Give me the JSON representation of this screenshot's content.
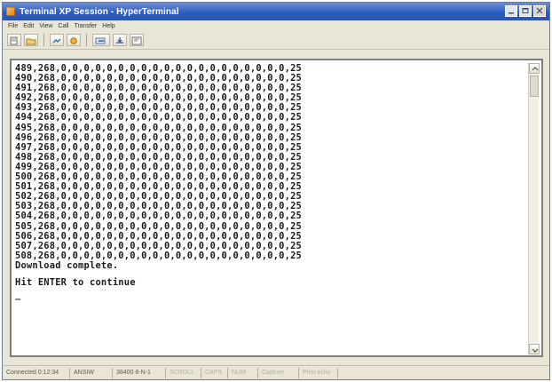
{
  "window": {
    "title": "Terminal XP Session - HyperTerminal",
    "minimize_label": "",
    "maximize_label": "",
    "close_label": ""
  },
  "menu": {
    "items": [
      {
        "label": "File"
      },
      {
        "label": "Edit"
      },
      {
        "label": "View"
      },
      {
        "label": "Call"
      },
      {
        "label": "Transfer"
      },
      {
        "label": "Help"
      }
    ]
  },
  "toolbar": {
    "icons": [
      "new-connection-icon",
      "open-icon",
      "connect-icon",
      "disconnect-icon",
      "send-icon",
      "receive-icon",
      "properties-icon"
    ]
  },
  "terminal": {
    "lines": [
      "489,268,0,0,0,0,0,0,0,0,0,0,0,0,0,0,0,0,0,0,0,0,25",
      "490,268,0,0,0,0,0,0,0,0,0,0,0,0,0,0,0,0,0,0,0,0,25",
      "491,268,0,0,0,0,0,0,0,0,0,0,0,0,0,0,0,0,0,0,0,0,25",
      "492,268,0,0,0,0,0,0,0,0,0,0,0,0,0,0,0,0,0,0,0,0,25",
      "493,268,0,0,0,0,0,0,0,0,0,0,0,0,0,0,0,0,0,0,0,0,25",
      "494,268,0,0,0,0,0,0,0,0,0,0,0,0,0,0,0,0,0,0,0,0,25",
      "495,268,0,0,0,0,0,0,0,0,0,0,0,0,0,0,0,0,0,0,0,0,25",
      "496,268,0,0,0,0,0,0,0,0,0,0,0,0,0,0,0,0,0,0,0,0,25",
      "497,268,0,0,0,0,0,0,0,0,0,0,0,0,0,0,0,0,0,0,0,0,25",
      "498,268,0,0,0,0,0,0,0,0,0,0,0,0,0,0,0,0,0,0,0,0,25",
      "499,268,0,0,0,0,0,0,0,0,0,0,0,0,0,0,0,0,0,0,0,0,25",
      "500,268,0,0,0,0,0,0,0,0,0,0,0,0,0,0,0,0,0,0,0,0,25",
      "501,268,0,0,0,0,0,0,0,0,0,0,0,0,0,0,0,0,0,0,0,0,25",
      "502,268,0,0,0,0,0,0,0,0,0,0,0,0,0,0,0,0,0,0,0,0,25",
      "503,268,0,0,0,0,0,0,0,0,0,0,0,0,0,0,0,0,0,0,0,0,25",
      "504,268,0,0,0,0,0,0,0,0,0,0,0,0,0,0,0,0,0,0,0,0,25",
      "505,268,0,0,0,0,0,0,0,0,0,0,0,0,0,0,0,0,0,0,0,0,25",
      "506,268,0,0,0,0,0,0,0,0,0,0,0,0,0,0,0,0,0,0,0,0,25",
      "507,268,0,0,0,0,0,0,0,0,0,0,0,0,0,0,0,0,0,0,0,0,25",
      "508,268,0,0,0,0,0,0,0,0,0,0,0,0,0,0,0,0,0,0,0,0,25"
    ],
    "download_message": "Download complete.",
    "prompt": "Hit ENTER to continue",
    "cursor": "_"
  },
  "status": {
    "items": [
      {
        "label": "Connected 0:12:34",
        "dim": false
      },
      {
        "label": "ANSIW",
        "dim": false
      },
      {
        "label": "38400 8-N-1",
        "dim": false
      },
      {
        "label": "SCROLL",
        "dim": true
      },
      {
        "label": "CAPS",
        "dim": true
      },
      {
        "label": "NUM",
        "dim": true
      },
      {
        "label": "Capture",
        "dim": true
      },
      {
        "label": "Print echo",
        "dim": true
      }
    ]
  }
}
